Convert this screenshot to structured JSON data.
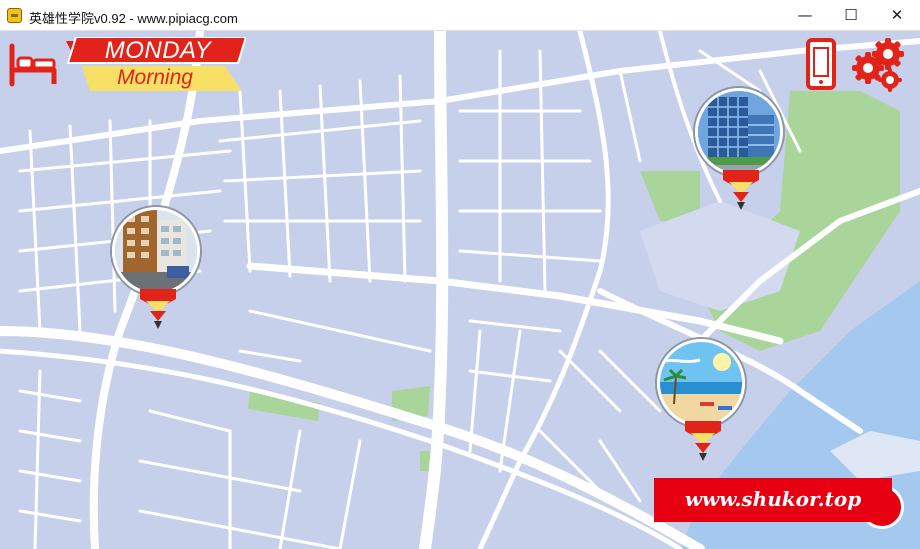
{
  "window": {
    "title": "英雄性学院v0.92 - www.pipiacg.com",
    "min_glyph": "—",
    "max_glyph": "☐",
    "close_glyph": "✕"
  },
  "hud": {
    "day": "MONDAY",
    "time_of_day": "Morning",
    "icons": [
      "bed-icon",
      "phone-icon",
      "gear-icon"
    ]
  },
  "locations": [
    {
      "id": "apartment",
      "icon": "apartment-building-photo"
    },
    {
      "id": "office",
      "icon": "office-tower-photo"
    },
    {
      "id": "beach",
      "icon": "beach-photo"
    }
  ],
  "watermark": {
    "text": "www.shukor.top"
  },
  "colors": {
    "map_bg": "#c7d0ea",
    "road": "#ffffff",
    "park": "#a9d59a",
    "water": "#a5c8ef",
    "accent_red": "#e2231a",
    "accent_yellow": "#f7e066"
  }
}
